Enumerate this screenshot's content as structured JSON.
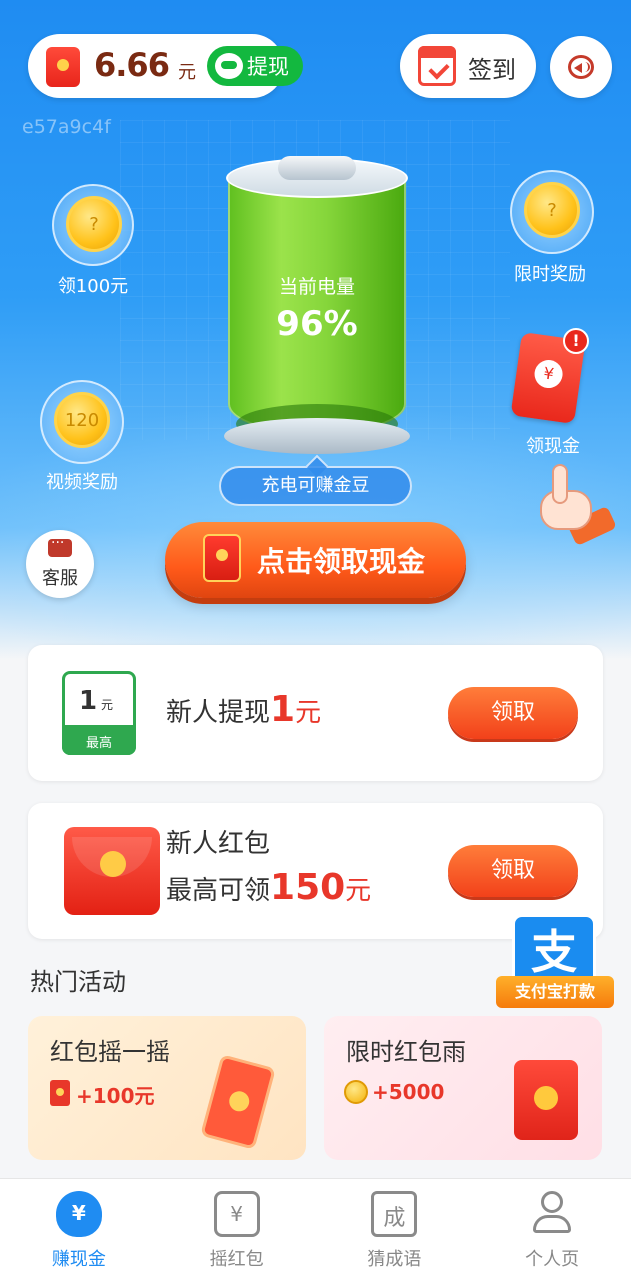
{
  "header": {
    "balance_amount": "6.66",
    "balance_unit": "元",
    "withdraw_label": "提现",
    "signin_label": "签到",
    "device_id": "e57a9c4f"
  },
  "battery": {
    "title": "当前电量",
    "level_text": "96%",
    "level": 0.96,
    "charge_hint": "充电可赚金豆"
  },
  "floating": {
    "coin_100_label": "领100元",
    "coin_100_symbol": "?",
    "limited_reward_label": "限时奖励",
    "limited_reward_symbol": "?",
    "video_reward_label": "视频奖励",
    "video_reward_value": "120",
    "cash_label": "领现金",
    "cash_symbol": "¥",
    "alert_mark": "!",
    "service_label": "客服"
  },
  "main_button": {
    "label": "点击领取现金"
  },
  "cards": [
    {
      "prefix": "新人提现",
      "amount": "1",
      "unit": "元",
      "cert_value": "1",
      "cert_unit": "元",
      "cert_badge": "最高",
      "button": "领取"
    },
    {
      "line1": "新人红包",
      "line2_prefix": "最高可领",
      "amount": "150",
      "unit": "元",
      "button": "领取"
    }
  ],
  "alipay": {
    "glyph": "支",
    "ribbon": "支付宝打款"
  },
  "hot_section": {
    "title": "热门活动",
    "items": [
      {
        "title": "红包摇一摇",
        "reward": "+100元"
      },
      {
        "title": "限时红包雨",
        "reward": "+5000"
      }
    ]
  },
  "tabbar": [
    {
      "label": "赚现金",
      "icon": "money-bag-icon",
      "active": true
    },
    {
      "label": "摇红包",
      "icon": "red-envelope-icon",
      "active": false
    },
    {
      "label": "猜成语",
      "icon": "idiom-icon",
      "active": false
    },
    {
      "label": "个人页",
      "icon": "user-icon",
      "active": false
    }
  ],
  "colors": {
    "primary_blue": "#1f8cf2",
    "accent_orange": "#ff5a1a",
    "red": "#e8372a",
    "green": "#13b83f"
  }
}
